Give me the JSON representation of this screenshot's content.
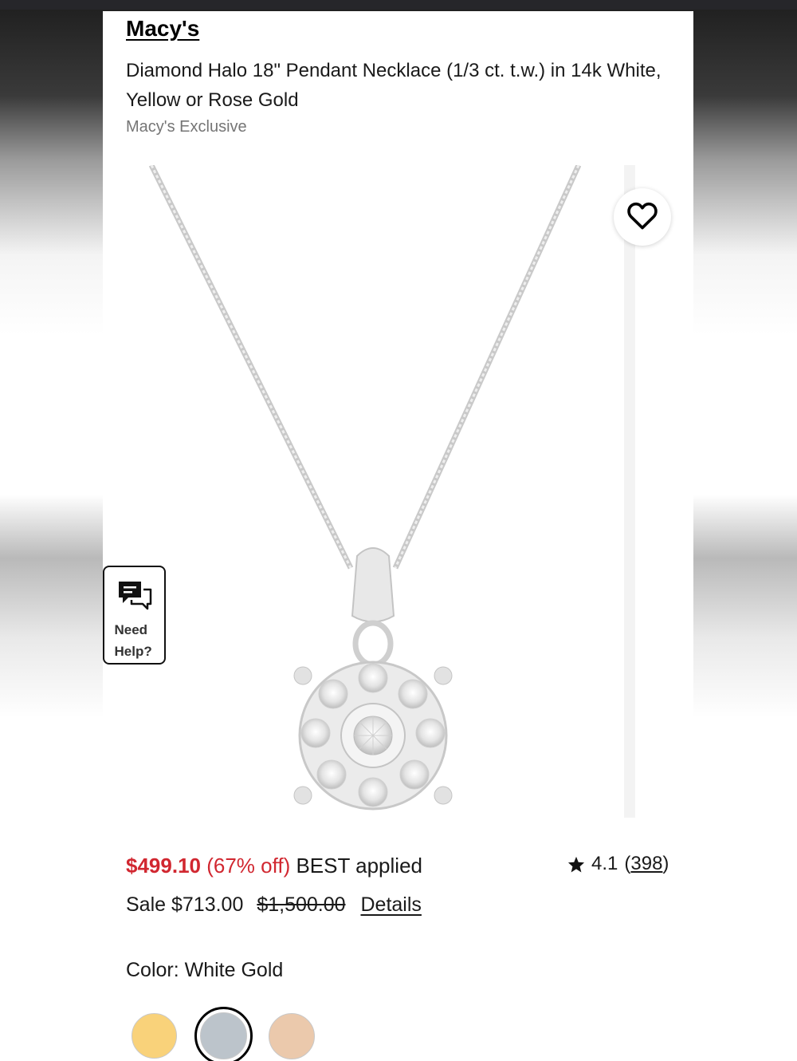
{
  "product": {
    "brand": "Macy's",
    "title": "Diamond Halo 18\" Pendant Necklace (1/3 ct. t.w.) in 14k White, Yellow or Rose Gold",
    "exclusive": "Macy's Exclusive"
  },
  "help": {
    "line1": "Need",
    "line2": "Help?"
  },
  "pricing": {
    "current": "$499.10",
    "discount": "(67% off)",
    "promo": "BEST applied",
    "sale": "Sale $713.00",
    "original": "$1,500.00",
    "details_link": "Details"
  },
  "rating": {
    "score": "4.1",
    "count": "398"
  },
  "color": {
    "label": "Color: White Gold",
    "swatches": [
      {
        "name": "Yellow Gold",
        "hex": "#f9d27a"
      },
      {
        "name": "White Gold",
        "hex": "#bcc4cb",
        "selected": true
      },
      {
        "name": "Rose Gold",
        "hex": "#ebc9ac"
      }
    ]
  },
  "colors": {
    "price_red": "#d12730",
    "text": "#1a1a1a",
    "muted": "#757575"
  }
}
